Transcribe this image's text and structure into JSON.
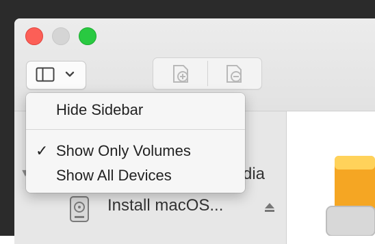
{
  "window": {
    "toolbar": {
      "sidebar_toggle_icon": "sidebar-toggle-icon",
      "chevron_icon": "chevron-down-icon",
      "segmented_buttons": [
        {
          "icon": "add-volume-icon"
        },
        {
          "icon": "remove-volume-icon"
        }
      ]
    },
    "sidebar": {
      "truncated_label": "dia",
      "items": [
        {
          "label": "Install macOS...",
          "icon": "drive-icon",
          "action_icon": "eject-icon"
        }
      ]
    }
  },
  "menu": {
    "items": [
      {
        "label": "Hide Sidebar",
        "checked": false
      },
      {
        "label": "Show Only Volumes",
        "checked": true,
        "check_glyph": "✓"
      },
      {
        "label": "Show All Devices",
        "checked": false
      }
    ]
  },
  "colors": {
    "close": "#fc5f57",
    "minimize_disabled": "#d5d5d5",
    "zoom": "#29c941",
    "disk_orange": "#f5a623"
  }
}
